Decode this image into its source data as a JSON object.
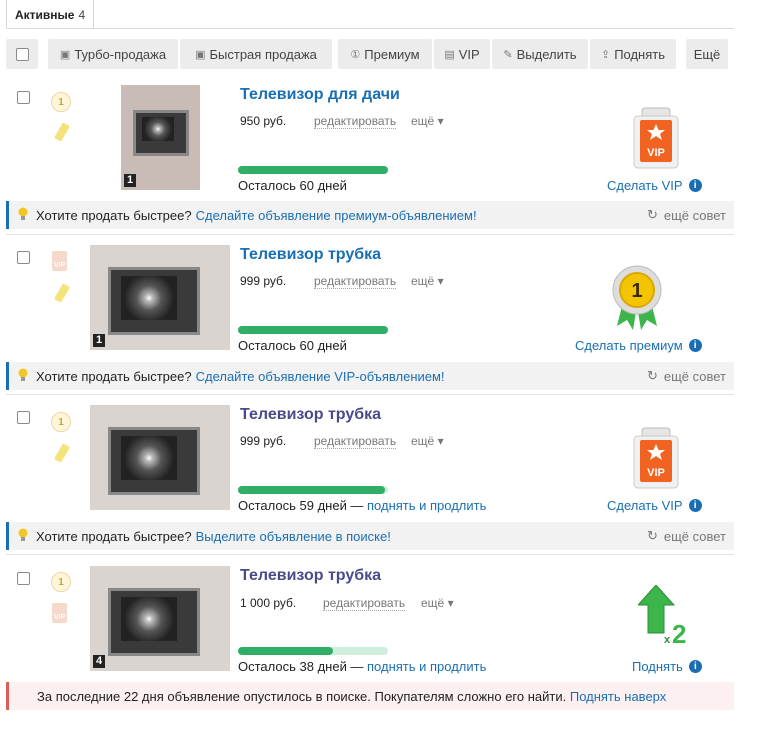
{
  "tabs": [
    {
      "label": "Активные",
      "count": "4"
    }
  ],
  "toolbar": {
    "turbo": "Турбо-продажа",
    "fast": "Быстрая продажа",
    "premium": "Премиум",
    "vip": "VIP",
    "highlight": "Выделить",
    "raise": "Поднять",
    "more": "Ещё"
  },
  "items": [
    {
      "title": "Телевизор для дачи",
      "price": "950 руб.",
      "edit": "редактировать",
      "more": "ещё",
      "photo_count": "1",
      "remaining": "Осталось 60 дней",
      "remaining_fraction": 1.0,
      "extend": "",
      "action": "Сделать VIP"
    },
    {
      "title": "Телевизор трубка",
      "price": "999 руб.",
      "edit": "редактировать",
      "more": "ещё",
      "photo_count": "1",
      "remaining": "Осталось 60 дней",
      "remaining_fraction": 1.0,
      "extend": "",
      "action": "Сделать премиум"
    },
    {
      "title": "Телевизор трубка",
      "price": "999 руб.",
      "edit": "редактировать",
      "more": "ещё",
      "photo_count": "",
      "remaining": "Осталось 59 дней —",
      "remaining_fraction": 0.98,
      "extend": "поднять и продлить",
      "action": "Сделать VIP"
    },
    {
      "title": "Телевизор трубка",
      "price": "1 000 руб.",
      "edit": "редактировать",
      "more": "ещё",
      "photo_count": "4",
      "remaining": "Осталось 38 дней —",
      "remaining_fraction": 0.63,
      "extend": "поднять и продлить",
      "action": "Поднять"
    }
  ],
  "tips": [
    {
      "question": "Хотите продать быстрее?",
      "link": "Сделайте объявление премиум-объявлением!",
      "more": "ещё совет"
    },
    {
      "question": "Хотите продать быстрее?",
      "link": "Сделайте объявление VIP-объявлением!",
      "more": "ещё совет"
    },
    {
      "question": "Хотите продать быстрее?",
      "link": "Выделите объявление в поиске!",
      "more": "ещё совет"
    }
  ],
  "warning": {
    "text": "За последние 22 дня объявление опустилось в поиске. Покупателям сложно его найти.",
    "link": "Поднять наверх"
  },
  "badges": {
    "vip_label": "VIP",
    "premium_number": "1",
    "raise_multiplier": "x2"
  },
  "colors": {
    "link": "#1a6fb4",
    "progress": "#2fae68",
    "vip": "#f26322",
    "premium_gold": "#f5c400",
    "raise_green": "#3cb54a"
  }
}
